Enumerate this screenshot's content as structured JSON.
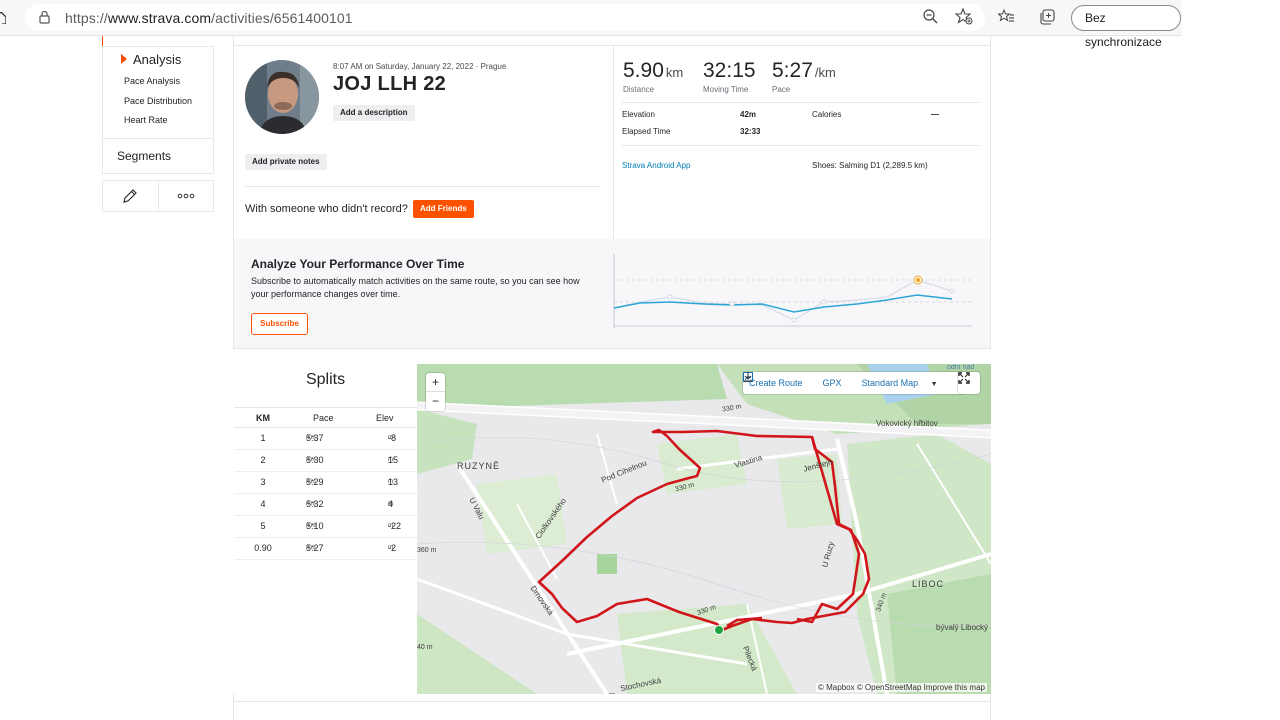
{
  "browser": {
    "url_prefix": "https://",
    "url_host": "www.strava.com",
    "url_path": "/activities/6561400101",
    "sync_label": "Bez synchronizace"
  },
  "sidebar": {
    "analysis_label": "Analysis",
    "sub_items": [
      "Pace Analysis",
      "Pace Distribution",
      "Heart Rate"
    ],
    "segments_label": "Segments"
  },
  "activity": {
    "date_location": "8:07 AM on Saturday, January 22, 2022 · Prague",
    "title": "JOJ LLH 22",
    "add_description": "Add a description",
    "add_private_notes": "Add private notes",
    "with_someone": "With someone who didn't record?",
    "add_friends": "Add Friends"
  },
  "stats": {
    "distance": {
      "value": "5.90",
      "unit": "km",
      "label": "Distance"
    },
    "moving_time": {
      "value": "32:15",
      "label": "Moving Time"
    },
    "pace": {
      "value": "5:27",
      "unit": "/km",
      "label": "Pace"
    },
    "elevation_label": "Elevation",
    "elevation_value": "42m",
    "elapsed_label": "Elapsed Time",
    "elapsed_value": "32:33",
    "calories_label": "Calories",
    "calories_value": "—",
    "device": "Strava Android App",
    "shoes": "Shoes: Salming D1 (2,289.5 km)"
  },
  "performance": {
    "title": "Analyze Your Performance Over Time",
    "description": "Subscribe to automatically match activities on the same route, so you can see how your performance changes over time.",
    "subscribe": "Subscribe",
    "accent": "#fc5200",
    "line_color": "#2ba4d6"
  },
  "splits": {
    "title": "Splits",
    "headers": [
      "KM",
      "Pace",
      "Elev"
    ],
    "pace_unit": "/km",
    "elev_unit": "m",
    "rows": [
      {
        "km": "1",
        "pace": "5:37",
        "elev": "-8"
      },
      {
        "km": "2",
        "pace": "5:30",
        "elev": "15"
      },
      {
        "km": "3",
        "pace": "5:29",
        "elev": "13"
      },
      {
        "km": "4",
        "pace": "5:32",
        "elev": "4"
      },
      {
        "km": "5",
        "pace": "5:10",
        "elev": "-22"
      },
      {
        "km": "0.90",
        "pace": "5:27",
        "elev": "-2"
      }
    ]
  },
  "map": {
    "zoom_in": "+",
    "zoom_out": "−",
    "create_route": "Create Route",
    "gpx": "GPX",
    "map_style": "Standard Map",
    "attribution": "© Mapbox © OpenStreetMap Improve this map",
    "labels": {
      "ruzyne": "RUZYNĚ",
      "liboc": "LIBOC",
      "vokovicky": "Vokovický hřbitov",
      "byvaly": "bývalý Libocký",
      "pod_cihelnou": "Pod Cihelnou",
      "vlastina": "Vlastina",
      "u_valu": "U Valu",
      "drnovska": "Drnovská",
      "stochovska": "Stochovská",
      "pilicska": "Pilecká",
      "u_ruzy": "U Ruzy",
      "jenstejn": "Jenštejn",
      "ciolkovskeho": "Ciolkovského",
      "c330a": "330 m",
      "c330b": "330 m",
      "c330c": "330 m",
      "c330d": "330 m",
      "c360": "360 m",
      "c340": "340 m",
      "c40": "40 m",
      "vodni_nadrz": "odní nád"
    },
    "route_color": "#d0161b",
    "start_color": "#1ea341"
  }
}
